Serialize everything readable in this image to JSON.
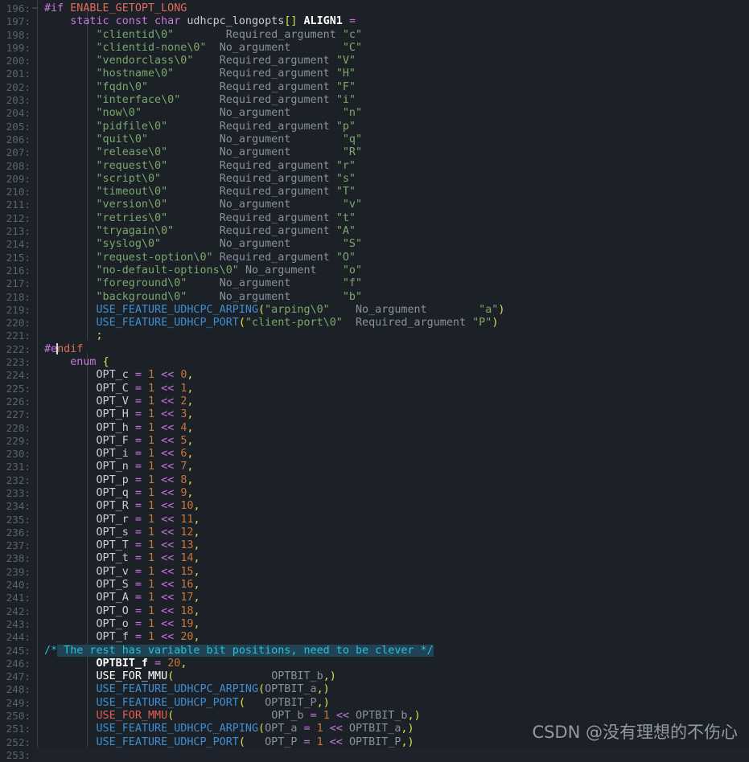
{
  "editor": {
    "language": "C",
    "theme": "one-dark",
    "first_line": 196,
    "last_line": 253,
    "cursor_line": 222,
    "cursor_column": 3,
    "colors": {
      "background": "#1c2027",
      "gutter_text": "#5c6370",
      "selection": "#204455",
      "preprocessor": "#c678dd",
      "preprocessor_id": "#e06c5e",
      "keyword": "#c678dd",
      "string": "#7aa96a",
      "number": "#c9763a",
      "comment": "#2bbfd9",
      "macro_blue": "#3d8fd1",
      "macro_red": "#e05c54",
      "bracket": "#d9e04a",
      "identifier": "#abb2bf",
      "cursor": "#d7dae0",
      "indent_guide": "#3a404b"
    }
  },
  "watermark": {
    "text": "CSDN @没有理想的不伤心"
  },
  "lines": [
    {
      "n": 196,
      "fold": "-"
    },
    {
      "n": 197,
      "fold": ""
    },
    {
      "n": 198,
      "fold": ""
    },
    {
      "n": 199,
      "fold": ""
    },
    {
      "n": 200,
      "fold": ""
    },
    {
      "n": 201,
      "fold": ""
    },
    {
      "n": 202,
      "fold": ""
    },
    {
      "n": 203,
      "fold": ""
    },
    {
      "n": 204,
      "fold": ""
    },
    {
      "n": 205,
      "fold": ""
    },
    {
      "n": 206,
      "fold": ""
    },
    {
      "n": 207,
      "fold": ""
    },
    {
      "n": 208,
      "fold": ""
    },
    {
      "n": 209,
      "fold": ""
    },
    {
      "n": 210,
      "fold": ""
    },
    {
      "n": 211,
      "fold": ""
    },
    {
      "n": 212,
      "fold": ""
    },
    {
      "n": 213,
      "fold": ""
    },
    {
      "n": 214,
      "fold": ""
    },
    {
      "n": 215,
      "fold": ""
    },
    {
      "n": 216,
      "fold": ""
    },
    {
      "n": 217,
      "fold": ""
    },
    {
      "n": 218,
      "fold": ""
    },
    {
      "n": 219,
      "fold": ""
    },
    {
      "n": 220,
      "fold": ""
    },
    {
      "n": 221,
      "fold": ""
    },
    {
      "n": 222,
      "fold": ""
    },
    {
      "n": 223,
      "fold": ""
    },
    {
      "n": 224,
      "fold": ""
    },
    {
      "n": 225,
      "fold": ""
    },
    {
      "n": 226,
      "fold": ""
    },
    {
      "n": 227,
      "fold": ""
    },
    {
      "n": 228,
      "fold": ""
    },
    {
      "n": 229,
      "fold": ""
    },
    {
      "n": 230,
      "fold": ""
    },
    {
      "n": 231,
      "fold": ""
    },
    {
      "n": 232,
      "fold": ""
    },
    {
      "n": 233,
      "fold": ""
    },
    {
      "n": 234,
      "fold": ""
    },
    {
      "n": 235,
      "fold": ""
    },
    {
      "n": 236,
      "fold": ""
    },
    {
      "n": 237,
      "fold": ""
    },
    {
      "n": 238,
      "fold": ""
    },
    {
      "n": 239,
      "fold": ""
    },
    {
      "n": 240,
      "fold": ""
    },
    {
      "n": 241,
      "fold": ""
    },
    {
      "n": 242,
      "fold": ""
    },
    {
      "n": 243,
      "fold": ""
    },
    {
      "n": 244,
      "fold": ""
    },
    {
      "n": 245,
      "fold": ""
    },
    {
      "n": 246,
      "fold": ""
    },
    {
      "n": 247,
      "fold": ""
    },
    {
      "n": 248,
      "fold": ""
    },
    {
      "n": 249,
      "fold": ""
    },
    {
      "n": 250,
      "fold": ""
    },
    {
      "n": 251,
      "fold": ""
    },
    {
      "n": 252,
      "fold": ""
    },
    {
      "n": 253,
      "fold": ""
    }
  ],
  "code": {
    "196": "#if ENABLE_GETOPT_LONG",
    "197": "        static const char udhcpc_longopts[] ALIGN1 =",
    "198": "                \"clientid\\0\"        Required_argument \"c\"",
    "199": "                \"clientid-none\\0\"  No_argument        \"C\"",
    "200": "                \"vendorclass\\0\"    Required_argument \"V\"",
    "201": "                \"hostname\\0\"       Required_argument \"H\"",
    "202": "                \"fqdn\\0\"           Required_argument \"F\"",
    "203": "                \"interface\\0\"      Required_argument \"i\"",
    "204": "                \"now\\0\"            No_argument        \"n\"",
    "205": "                \"pidfile\\0\"        Required_argument \"p\"",
    "206": "                \"quit\\0\"           No_argument        \"q\"",
    "207": "                \"release\\0\"        No_argument        \"R\"",
    "208": "                \"request\\0\"        Required_argument \"r\"",
    "209": "                \"script\\0\"         Required_argument \"s\"",
    "210": "                \"timeout\\0\"        Required_argument \"T\"",
    "211": "                \"version\\0\"        No_argument        \"v\"",
    "212": "                \"retries\\0\"        Required_argument \"t\"",
    "213": "                \"tryagain\\0\"       Required_argument \"A\"",
    "214": "                \"syslog\\0\"         No_argument        \"S\"",
    "215": "                \"request-option\\0\" Required_argument \"O\"",
    "216": "                \"no-default-options\\0\" No_argument    \"o\"",
    "217": "                \"foreground\\0\"     No_argument        \"f\"",
    "218": "                \"background\\0\"     No_argument        \"b\"",
    "219": "                USE_FEATURE_UDHCPC_ARPING(\"arping\\0\"    No_argument        \"a\")",
    "220": "                USE_FEATURE_UDHCP_PORT(\"client-port\\0\"  Required_argument \"P\")",
    "221": "                ;",
    "222": "#endif",
    "223": "        enum {",
    "224": "                OPT_c = 1 << 0,",
    "225": "                OPT_C = 1 << 1,",
    "226": "                OPT_V = 1 << 2,",
    "227": "                OPT_H = 1 << 3,",
    "228": "                OPT_h = 1 << 4,",
    "229": "                OPT_F = 1 << 5,",
    "230": "                OPT_i = 1 << 6,",
    "231": "                OPT_n = 1 << 7,",
    "232": "                OPT_p = 1 << 8,",
    "233": "                OPT_q = 1 << 9,",
    "234": "                OPT_R = 1 << 10,",
    "235": "                OPT_r = 1 << 11,",
    "236": "                OPT_s = 1 << 12,",
    "237": "                OPT_T = 1 << 13,",
    "238": "                OPT_t = 1 << 14,",
    "239": "                OPT_v = 1 << 15,",
    "240": "                OPT_S = 1 << 16,",
    "241": "                OPT_A = 1 << 17,",
    "242": "                OPT_O = 1 << 18,",
    "243": "                OPT_o = 1 << 19,",
    "244": "                OPT_f = 1 << 20,",
    "245": "/* The rest has variable bit positions, need to be clever */",
    "246": "                OPTBIT_f = 20,",
    "247": "                USE_FOR_MMU(               OPTBIT_b,)",
    "248": "                USE_FEATURE_UDHCPC_ARPING(OPTBIT_a,)",
    "249": "                USE_FEATURE_UDHCP_PORT(   OPTBIT_P,)",
    "250": "                USE_FOR_MMU(               OPT_b = 1 << OPTBIT_b,)",
    "251": "                USE_FEATURE_UDHCPC_ARPING(OPT_a = 1 << OPTBIT_a,)",
    "252": "                USE_FEATURE_UDHCP_PORT(   OPT_P = 1 << OPTBIT_P,)",
    "253": "        };"
  },
  "selection": {
    "line": 245,
    "text": "The rest has variable bit positions, need to be clever */"
  }
}
